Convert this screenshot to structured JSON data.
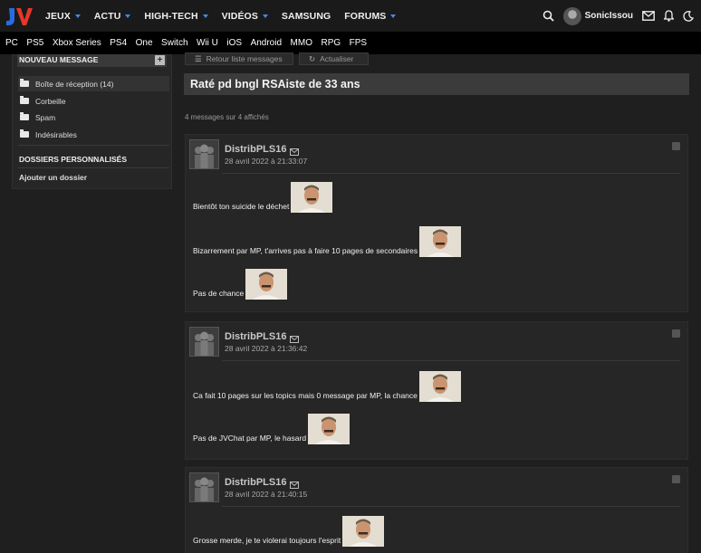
{
  "header": {
    "logo_text": "JV",
    "menu": [
      "JEUX",
      "ACTU",
      "HIGH-TECH",
      "VIDÉOS",
      "SAMSUNG",
      "FORUMS"
    ],
    "menu_dropdown": [
      true,
      true,
      true,
      true,
      false,
      true
    ],
    "username": "SonicIssou",
    "accent_color": "#3c8ee8",
    "logo_colors": [
      "#2a6be0",
      "#e8362a"
    ]
  },
  "platforms": [
    "PC",
    "PS5",
    "Xbox Series",
    "PS4",
    "One",
    "Switch",
    "Wii U",
    "iOS",
    "Android",
    "MMO",
    "RPG",
    "FPS"
  ],
  "sidebar": {
    "new_message": "NOUVEAU MESSAGE",
    "folders": [
      {
        "label": "Boîte de réception (14)",
        "active": true
      },
      {
        "label": "Corbeille",
        "active": false
      },
      {
        "label": "Spam",
        "active": false
      },
      {
        "label": "Indésirables",
        "active": false
      }
    ],
    "custom_folders_title": "DOSSIERS PERSONNALISÉS",
    "add_folder": "Ajouter un dossier"
  },
  "toolbar": {
    "back": "Retour liste messages",
    "refresh": "Actualiser"
  },
  "thread": {
    "title": "Raté pd bngl RSAiste de 33 ans",
    "count": "4 messages sur 4 affichés"
  },
  "messages": [
    {
      "author": "DistribPLS16",
      "date": "28 avril 2022 à 21:33:07",
      "lines": [
        "Bientôt ton suicide le déchet",
        "Bizarrement par MP, t'arrives pas à faire 10 pages de secondaires",
        "Pas de chance"
      ]
    },
    {
      "author": "DistribPLS16",
      "date": "28 avril 2022 à 21:36:42",
      "lines": [
        "Ca fait 10 pages sur les topics mais 0 message par MP, la chance",
        "Pas de JVChat par MP, le hasard"
      ]
    },
    {
      "author": "DistribPLS16",
      "date": "28 avril 2022 à 21:40:15",
      "lines": [
        "Grosse merde, je te violerai toujours l'esprit"
      ]
    }
  ]
}
